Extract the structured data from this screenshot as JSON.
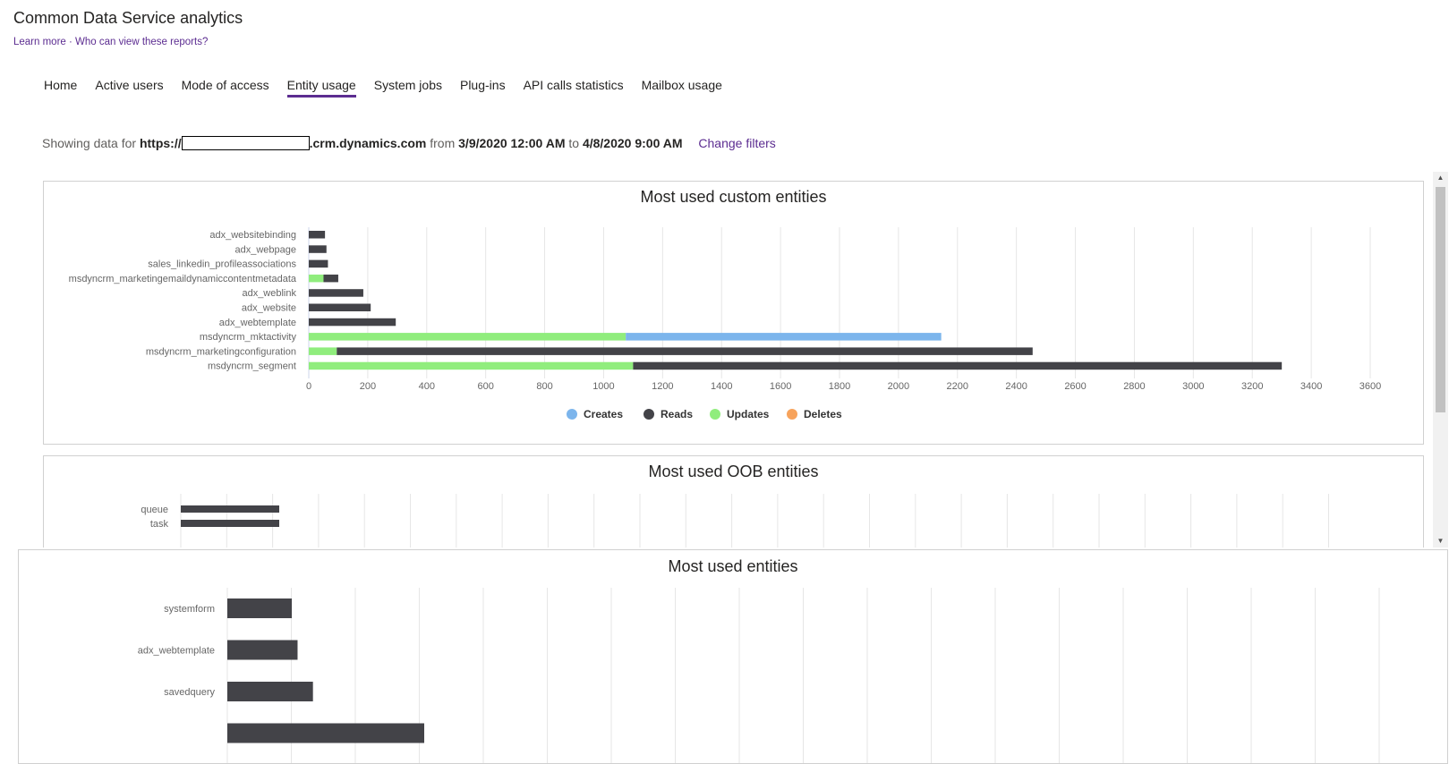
{
  "header": {
    "title": "Common Data Service analytics",
    "learn_more": "Learn more",
    "separator": " · ",
    "who_can_view": "Who can view these reports?"
  },
  "tabs": [
    {
      "label": "Home",
      "active": false
    },
    {
      "label": "Active users",
      "active": false
    },
    {
      "label": "Mode of access",
      "active": false
    },
    {
      "label": "Entity usage",
      "active": true
    },
    {
      "label": "System jobs",
      "active": false
    },
    {
      "label": "Plug-ins",
      "active": false
    },
    {
      "label": "API calls statistics",
      "active": false
    },
    {
      "label": "Mailbox usage",
      "active": false
    }
  ],
  "filters": {
    "showing_prefix": "Showing data for",
    "url_prefix": "https://",
    "url_suffix": ".crm.dynamics.com",
    "from_label": "from",
    "from_value": "3/9/2020 12:00 AM",
    "to_label": "to",
    "to_value": "4/8/2020 9:00 AM",
    "change_filters": "Change filters"
  },
  "colors": {
    "accent": "#5c2d91",
    "creates": "#7cb5ec",
    "reads": "#434348",
    "updates": "#90ed7d",
    "deletes": "#f7a35c"
  },
  "chart_data": [
    {
      "type": "bar",
      "title": "Most used custom entities",
      "orientation": "horizontal",
      "stacked": true,
      "categories": [
        "adx_websitebinding",
        "adx_webpage",
        "sales_linkedin_profileassociations",
        "msdyncrm_marketingemaildynamiccontentmetadata",
        "adx_weblink",
        "adx_website",
        "adx_webtemplate",
        "msdyncrm_mktactivity",
        "msdyncrm_marketingconfiguration",
        "msdyncrm_segment"
      ],
      "series": [
        {
          "name": "Creates",
          "color": "#7cb5ec",
          "values": [
            0,
            0,
            0,
            0,
            0,
            0,
            0,
            1070,
            0,
            0
          ]
        },
        {
          "name": "Reads",
          "color": "#434348",
          "values": [
            55,
            60,
            65,
            50,
            185,
            210,
            295,
            0,
            2360,
            2200
          ]
        },
        {
          "name": "Updates",
          "color": "#90ed7d",
          "values": [
            0,
            0,
            0,
            50,
            0,
            0,
            0,
            1075,
            95,
            1100
          ]
        },
        {
          "name": "Deletes",
          "color": "#f7a35c",
          "values": [
            0,
            0,
            0,
            0,
            0,
            0,
            0,
            0,
            0,
            0
          ]
        }
      ],
      "xlim": [
        0,
        3600
      ],
      "xticks": [
        0,
        200,
        400,
        600,
        800,
        1000,
        1200,
        1400,
        1600,
        1800,
        2000,
        2200,
        2400,
        2600,
        2800,
        3000,
        3200,
        3400,
        3600
      ],
      "grid": true,
      "legend": "bottom-center"
    },
    {
      "type": "bar",
      "title": "Most used OOB entities",
      "orientation": "horizontal",
      "categories": [
        "queue",
        "task"
      ],
      "series": [
        {
          "name": "Reads",
          "color": "#434348",
          "values": [
            110,
            110
          ]
        }
      ],
      "grid": true
    },
    {
      "type": "bar",
      "title": "Most used entities",
      "orientation": "horizontal",
      "categories": [
        "systemform",
        "adx_webtemplate",
        "savedquery"
      ],
      "series": [
        {
          "name": "Reads",
          "color": "#434348",
          "values": [
            67,
            73,
            89
          ]
        }
      ],
      "grid": true
    }
  ]
}
